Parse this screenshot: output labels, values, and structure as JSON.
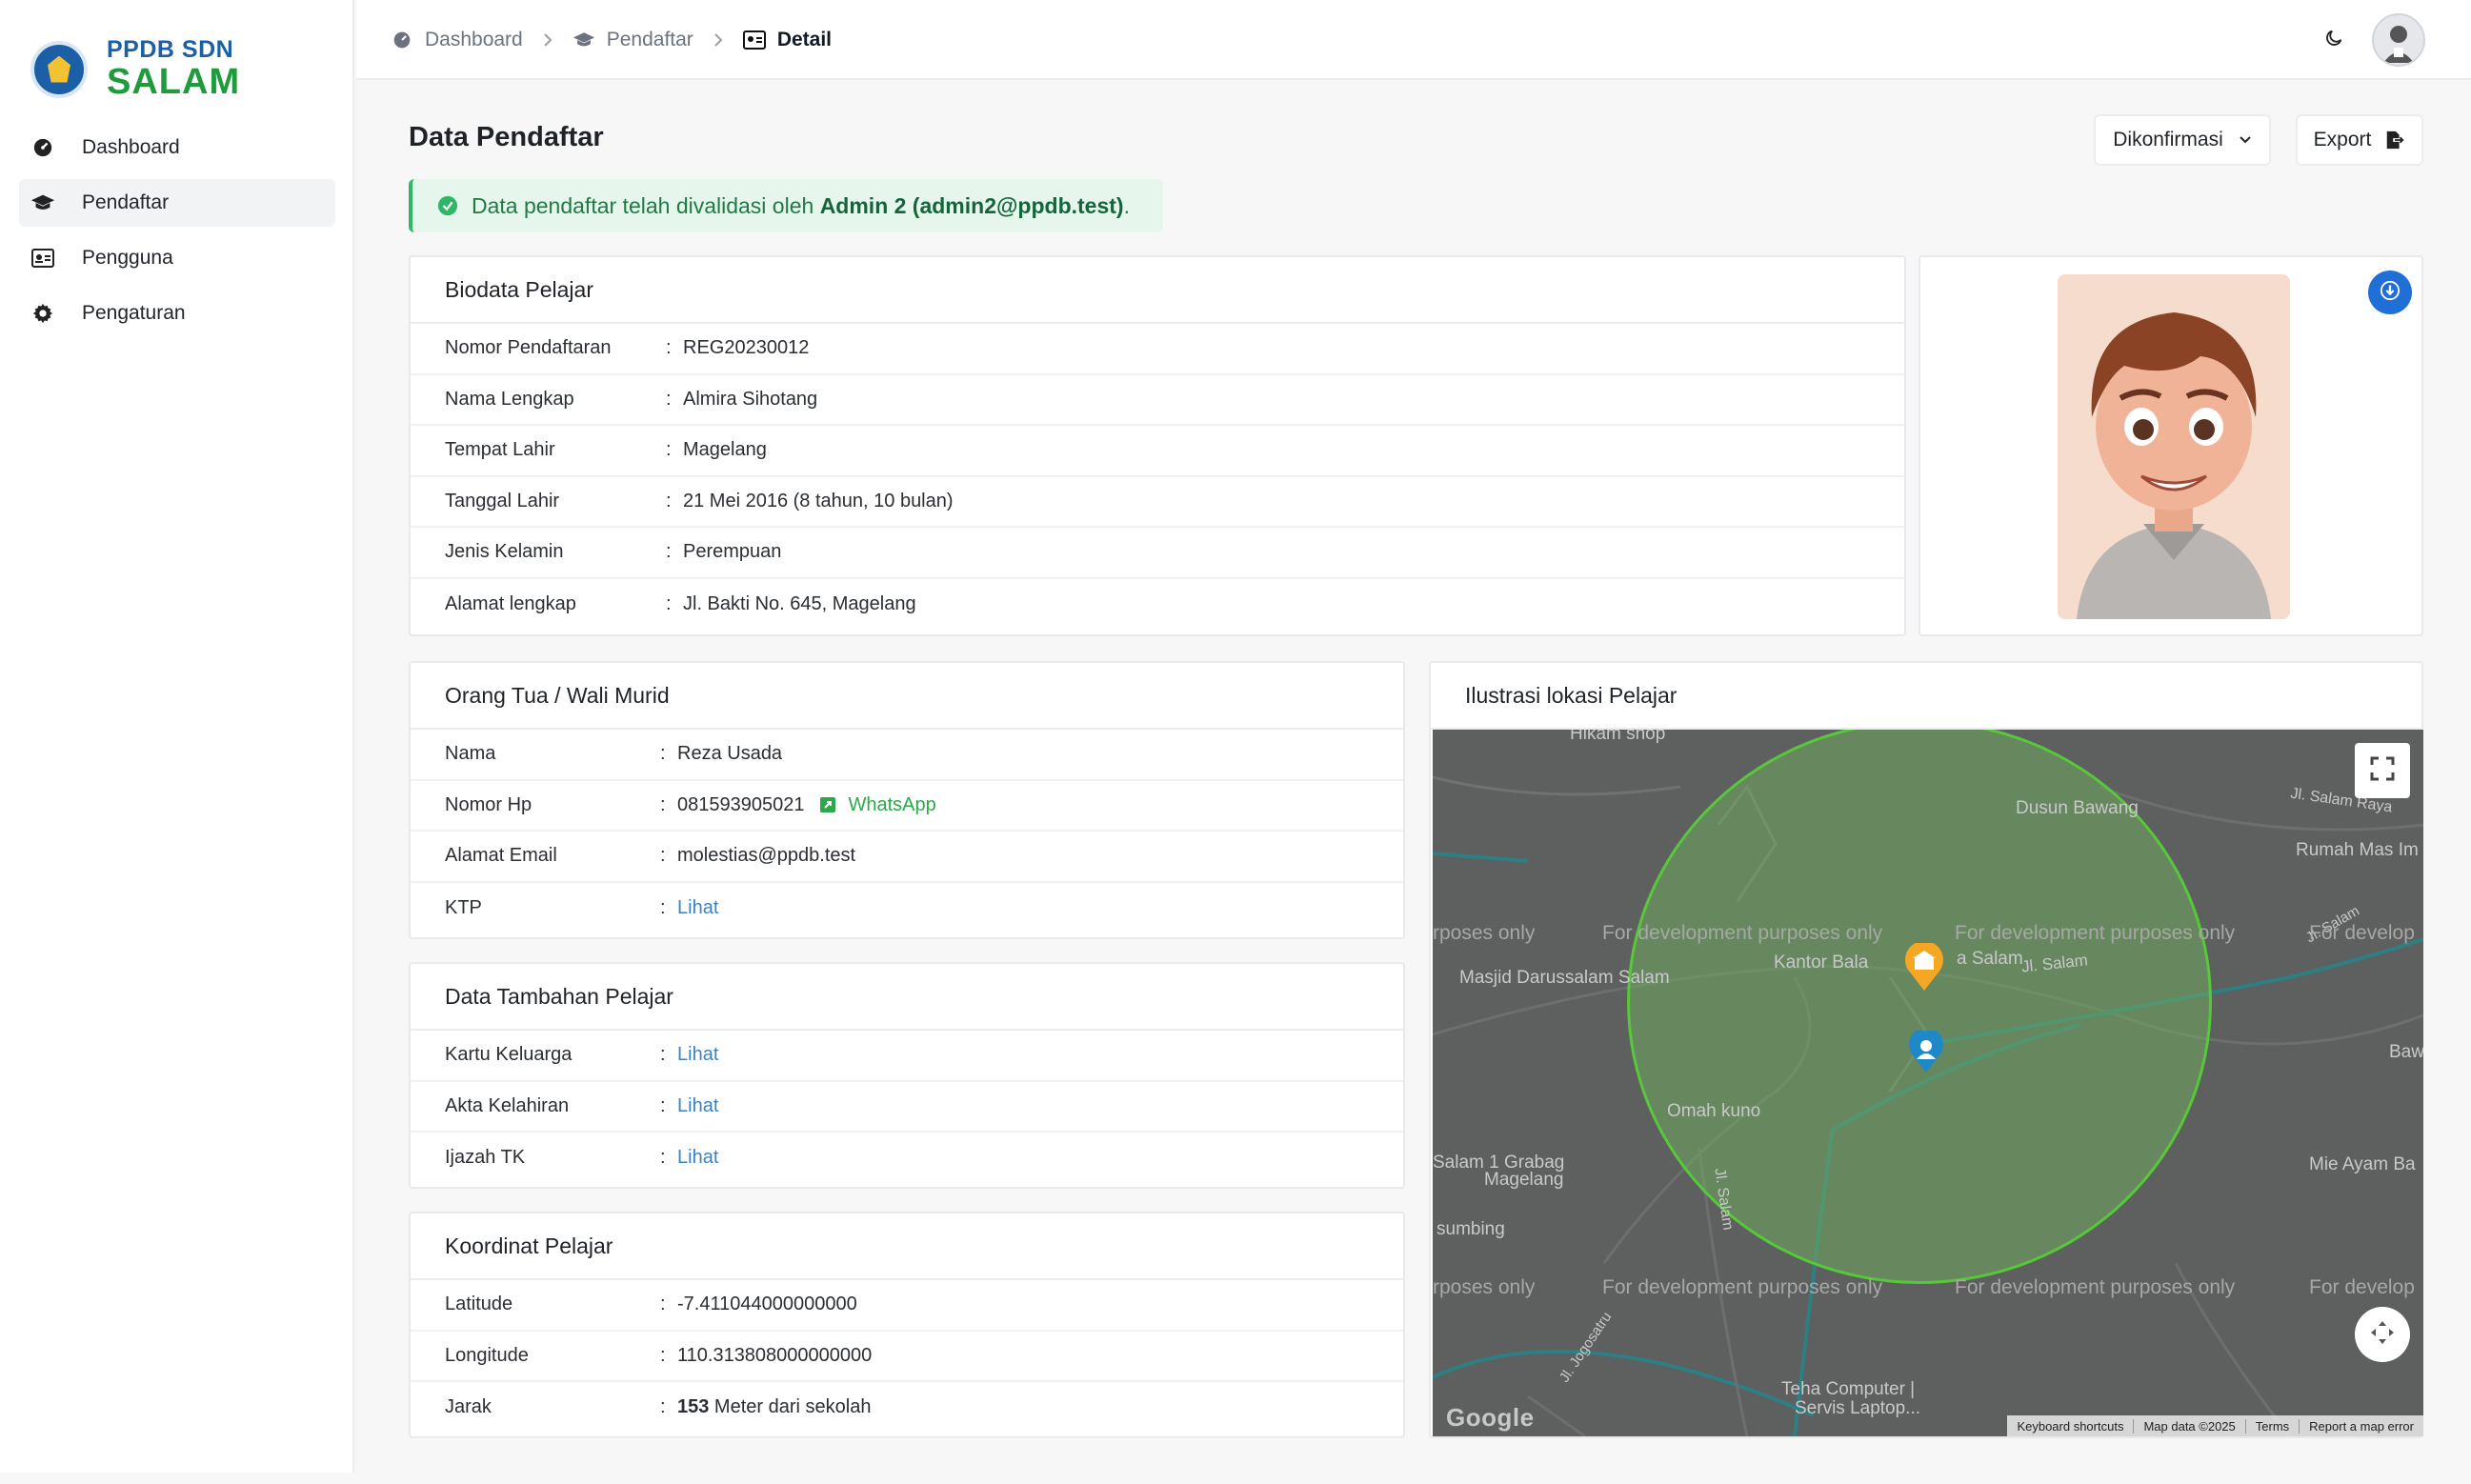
{
  "app": {
    "logo_top": "PPDB SDN",
    "logo_bottom": "SALAM"
  },
  "sidebar": {
    "items": [
      {
        "label": "Dashboard",
        "icon": "dashboard-icon",
        "active": false
      },
      {
        "label": "Pendaftar",
        "icon": "graduation-cap-icon",
        "active": true
      },
      {
        "label": "Pengguna",
        "icon": "id-card-icon",
        "active": false
      },
      {
        "label": "Pengaturan",
        "icon": "gear-icon",
        "active": false
      }
    ]
  },
  "breadcrumb": [
    {
      "label": "Dashboard",
      "icon": "dashboard-icon"
    },
    {
      "label": "Pendaftar",
      "icon": "graduation-cap-icon"
    },
    {
      "label": "Detail",
      "icon": "id-card-icon"
    }
  ],
  "page": {
    "title": "Data Pendaftar",
    "status_select": "Dikonfirmasi",
    "export_label": "Export",
    "alert_prefix": "Data pendaftar telah divalidasi oleh ",
    "alert_strong": "Admin 2 (admin2@ppdb.test)",
    "alert_suffix": "."
  },
  "biodata": {
    "title": "Biodata Pelajar",
    "rows": [
      {
        "label": "Nomor Pendaftaran",
        "value": "REG20230012"
      },
      {
        "label": "Nama Lengkap",
        "value": "Almira Sihotang"
      },
      {
        "label": "Tempat Lahir",
        "value": "Magelang"
      },
      {
        "label": "Tanggal Lahir",
        "value": "21 Mei 2016 (8 tahun, 10 bulan)"
      },
      {
        "label": "Jenis Kelamin",
        "value": "Perempuan"
      },
      {
        "label": "Alamat lengkap",
        "value": "Jl. Bakti No. 645, Magelang"
      }
    ]
  },
  "parent": {
    "title": "Orang Tua / Wali Murid",
    "nama_label": "Nama",
    "nama_value": "Reza Usada",
    "hp_label": "Nomor Hp",
    "hp_value": "081593905021",
    "wa_label": "WhatsApp",
    "email_label": "Alamat Email",
    "email_value": "molestias@ppdb.test",
    "ktp_label": "KTP",
    "ktp_link": "Lihat"
  },
  "extra": {
    "title": "Data Tambahan Pelajar",
    "rows": [
      {
        "label": "Kartu Keluarga",
        "link": "Lihat"
      },
      {
        "label": "Akta Kelahiran",
        "link": "Lihat"
      },
      {
        "label": "Ijazah TK",
        "link": "Lihat"
      }
    ]
  },
  "coords": {
    "title": "Koordinat Pelajar",
    "lat_label": "Latitude",
    "lat_value": "-7.411044000000000",
    "lng_label": "Longitude",
    "lng_value": "110.313808000000000",
    "dist_label": "Jarak",
    "dist_value": "153",
    "dist_suffix": " Meter dari sekolah"
  },
  "map": {
    "title": "Ilustrasi lokasi Pelajar",
    "labels": [
      "Hikam shop",
      "Dusun Bawang",
      "Jl. Salam Raya",
      "Rumah Mas Im",
      "Kantor Bala",
      "a Salam",
      "Jl. Salam",
      "Masjid Darussalam Salam",
      "Bawa",
      "Omah kuno",
      "Salam 1 Grabag",
      "Magelang",
      "Mie Ayam Ba",
      "sumbing",
      "Jl. Salam",
      "Teha Computer |",
      "Servis Laptop...",
      "Jl. Jogosatru",
      "Jl. Salam"
    ],
    "dev_text": "For development purposes only",
    "dev_text_left": "rposes only",
    "dev_text_right": "For develop",
    "attrib": [
      "Keyboard shortcuts",
      "Map data ©2025",
      "Terms",
      "Report a map error"
    ],
    "google": "Google",
    "school_marker_color": "#f5a623",
    "student_marker_color": "#1e88c9",
    "radius_color": "#57c83a"
  },
  "colors": {
    "accent": "#1f6fd6",
    "success": "#2fb765",
    "link": "#3b82c4",
    "whatsapp": "#2ba84a"
  }
}
